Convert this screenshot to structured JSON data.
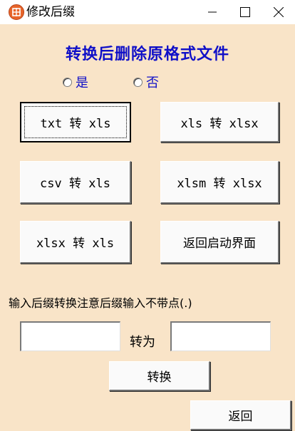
{
  "window": {
    "title": "修改后缀"
  },
  "heading": "转换后删除原格式文件",
  "radios": [
    {
      "label": "是",
      "checked": false
    },
    {
      "label": "否",
      "checked": false
    }
  ],
  "buttons": {
    "txt_to_xls": "txt 转 xls",
    "xls_to_xlsx": "xls 转 xlsx",
    "csv_to_xls": "csv 转 xls",
    "xlsm_to_xlsx": "xlsm 转 xlsx",
    "xlsx_to_xls": "xlsx 转 xls",
    "back_to_launch": "返回启动界面",
    "convert": "转换",
    "back": "返回"
  },
  "hint": "输入后缀转换注意后缀输入不带点(.)",
  "convert_form": {
    "from_value": "",
    "to_label": "转为",
    "to_value": ""
  },
  "colors": {
    "background": "#f9e4c8",
    "heading": "#1010c8",
    "radio_label": "#1010c8"
  }
}
